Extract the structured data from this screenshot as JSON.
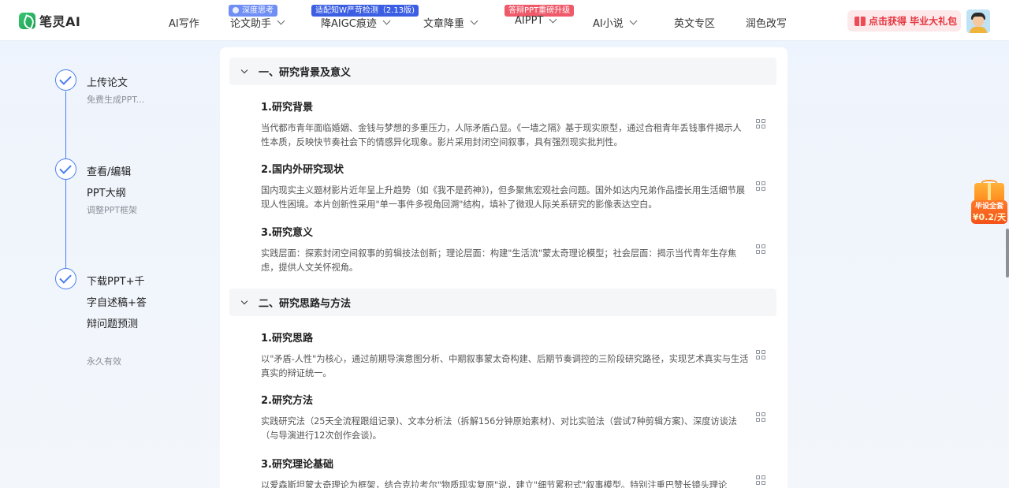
{
  "app": {
    "name": "笔灵AI"
  },
  "nav": {
    "items": [
      {
        "label": "AI写作"
      },
      {
        "label": "论文助手",
        "badge": "深度思考"
      },
      {
        "label": "降AIGC痕迹",
        "badge": "适配知W严苛检测（2.13版)"
      },
      {
        "label": "文章降重"
      },
      {
        "label": "AIPPT",
        "badge": "答辩PPT重磅升级"
      },
      {
        "label": "AI小说"
      },
      {
        "label": "英文专区"
      },
      {
        "label": "润色改写"
      }
    ],
    "promo_button": "点击获得 毕业大礼包"
  },
  "steps": [
    {
      "title": "上传论文",
      "subtitle": "免费生成PPT..."
    },
    {
      "title": "查看/编辑PPT大纲",
      "subtitle": "调整PPT框架"
    },
    {
      "title": "下载PPT+千字自述稿+答辩问题预测",
      "subtitle": "永久有效"
    }
  ],
  "outline": {
    "sections": [
      {
        "title": "一、研究背景及意义",
        "items": [
          {
            "title": "1.研究背景",
            "text": "当代都市青年面临婚姻、金钱与梦想的多重压力，人际矛盾凸显。《一墙之隔》基于现实原型，通过合租青年丢钱事件揭示人性本质，反映快节奏社会下的情感异化现象。影片采用封闭空间叙事，具有强烈现实批判性。"
          },
          {
            "title": "2.国内外研究现状",
            "text": "国内现实主义题材影片近年呈上升趋势（如《我不是药神》)，但多聚焦宏观社会问题。国外如达内兄弟作品擅长用生活细节展现人性困境。本片创新性采用\"单一事件多视角回溯\"结构，填补了微观人际关系研究的影像表达空白。"
          },
          {
            "title": "3.研究意义",
            "text": "实践层面：探索封闭空间叙事的剪辑技法创新；理论层面：构建\"生活流\"蒙太奇理论模型；社会层面：揭示当代青年生存焦虑，提供人文关怀视角。"
          }
        ]
      },
      {
        "title": "二、研究思路与方法",
        "items": [
          {
            "title": "1.研究思路",
            "text": "以\"矛盾-人性\"为核心，通过前期导演意图分析、中期叙事蒙太奇构建、后期节奏调控的三阶段研究路径，实现艺术真实与生活真实的辩证统一。"
          },
          {
            "title": "2.研究方法",
            "text": "实践研究法（25天全流程跟组记录)、文本分析法（拆解156分钟原始素材)、对比实验法（尝试7种剪辑方案)、深度访谈法（与导演进行12次创作会谈)。"
          },
          {
            "title": "3.研究理论基础",
            "text": "以爱森斯坦蒙太奇理论为框架，结合克拉考尔\"物质现实复原\"说，建立\"细节累积式\"叙事模型。特别注重巴赞长镜头理论"
          }
        ]
      }
    ]
  },
  "side_promo": {
    "line1": "毕设全套",
    "line2": "¥0.2/天"
  },
  "colors": {
    "accent": "#4a7ef0",
    "promo_red": "#e5353f",
    "brand_green": "#2fb866"
  }
}
